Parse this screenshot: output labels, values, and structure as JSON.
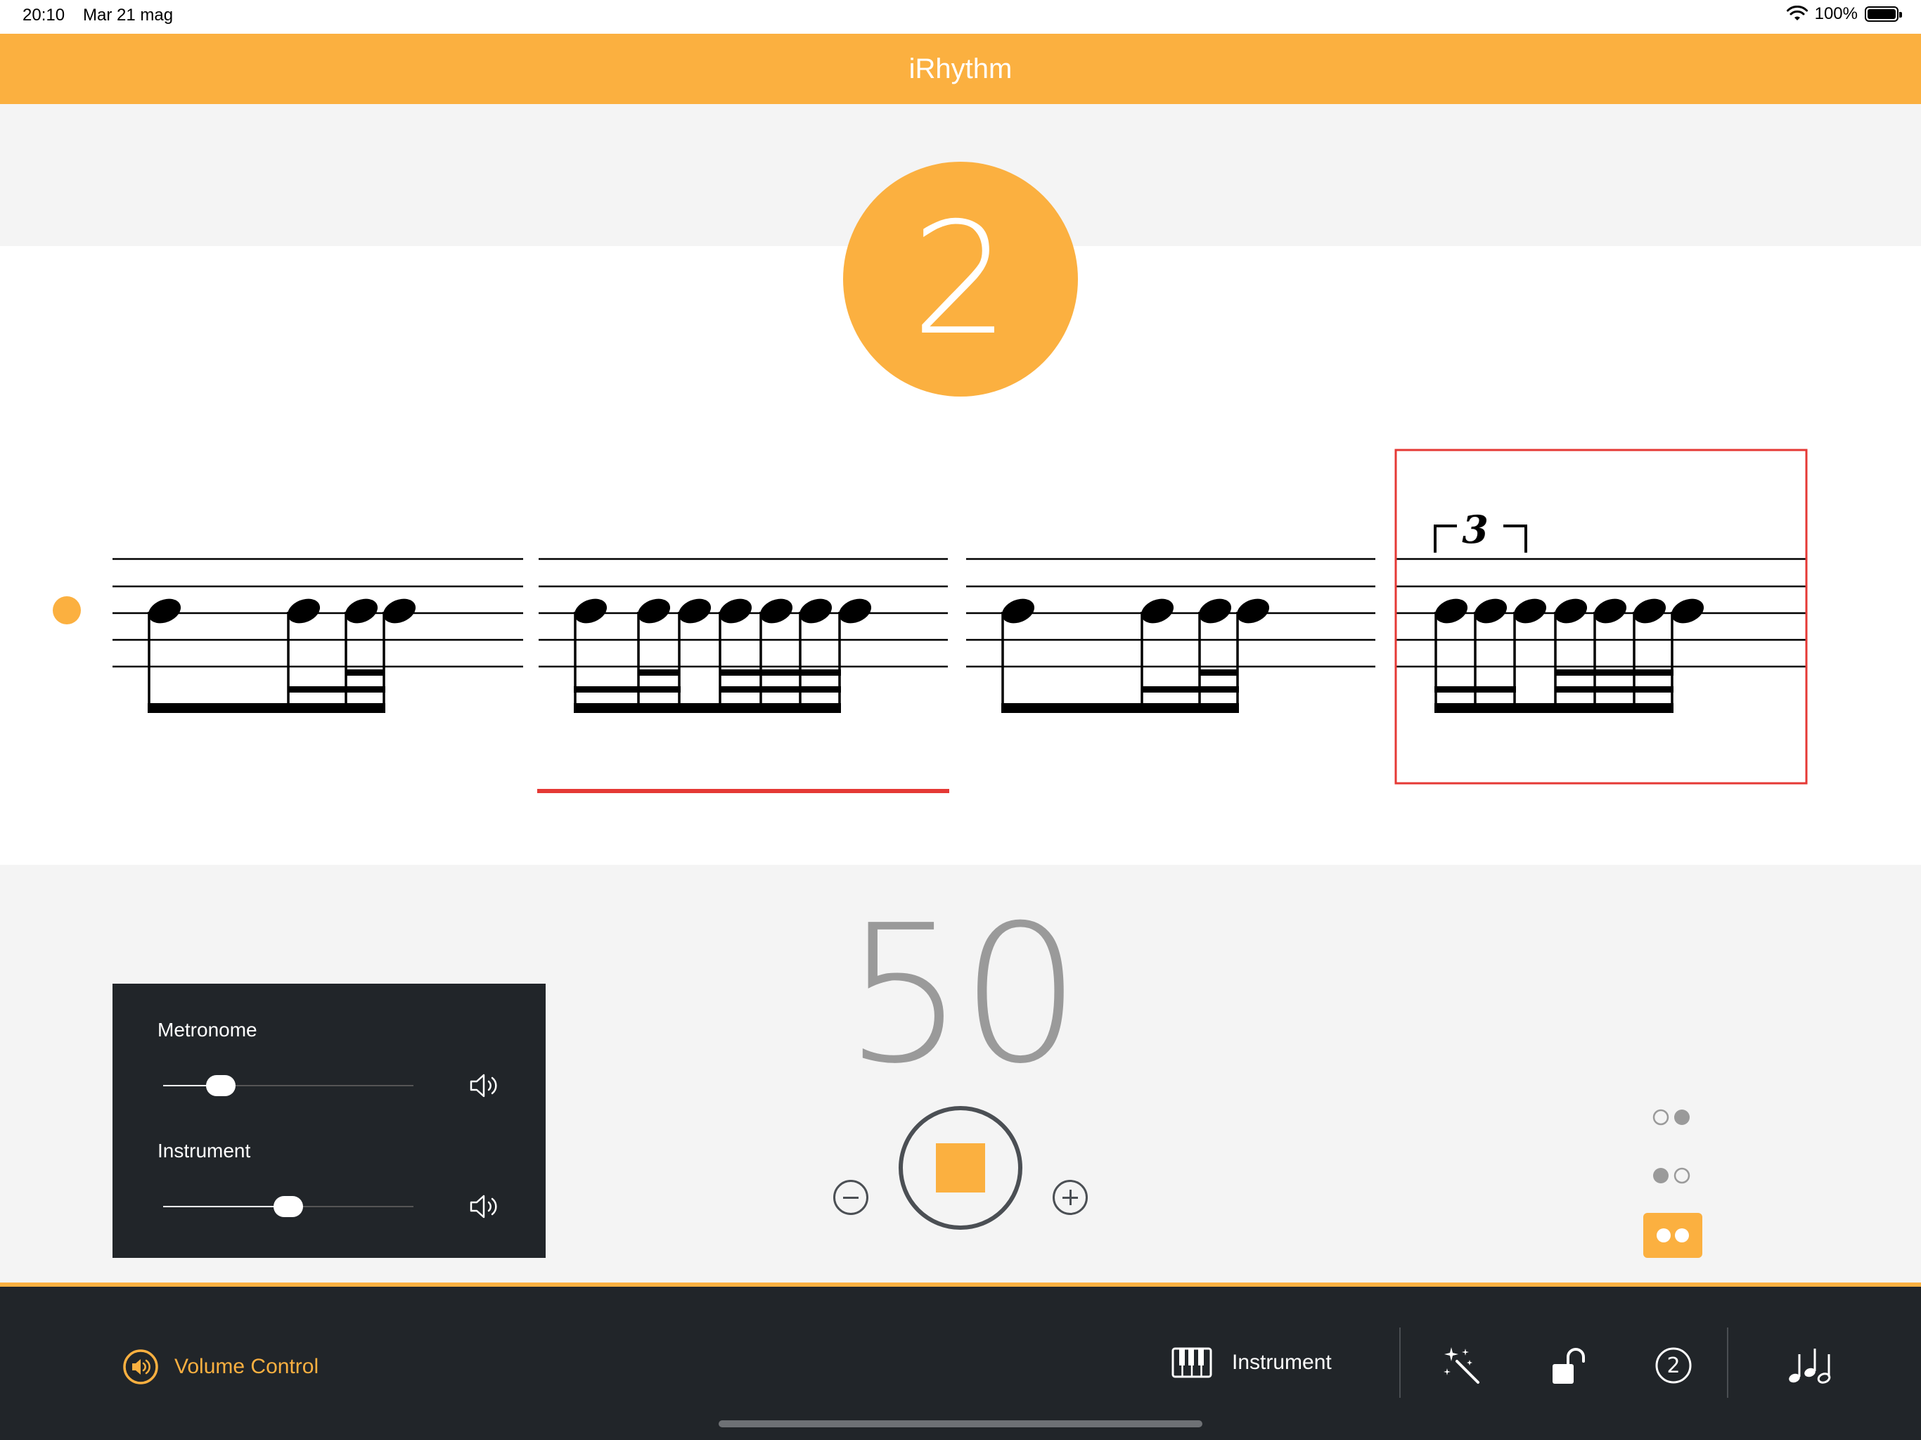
{
  "status_bar": {
    "time": "20:10",
    "date": "Mar 21 mag",
    "battery": "100%"
  },
  "app": {
    "title": "iRhythm"
  },
  "beat": {
    "current": "2"
  },
  "score": {
    "tuplet_number": "3",
    "active_measure": 2,
    "selected_measure": 4,
    "measure_count": 4
  },
  "tempo": {
    "bpm": "50"
  },
  "volume_panel": {
    "metronome_label": "Metronome",
    "metronome_level": 0.23,
    "instrument_label": "Instrument",
    "instrument_level": 0.5
  },
  "toolbar": {
    "volume_control_label": "Volume Control",
    "instrument_label": "Instrument",
    "count_in_value": "2"
  },
  "colors": {
    "accent": "#fbb040",
    "dark": "#212529",
    "error": "#e53935",
    "background_gray": "#f4f4f4"
  },
  "icons": {
    "metronome_speaker": "speaker-icon",
    "instrument_speaker": "speaker-icon",
    "volume_control": "volume-icon",
    "instrument": "piano-icon",
    "magic": "magic-wand-icon",
    "lock": "unlock-icon",
    "count_in": "count-in-icon",
    "notes": "music-notes-icon"
  }
}
